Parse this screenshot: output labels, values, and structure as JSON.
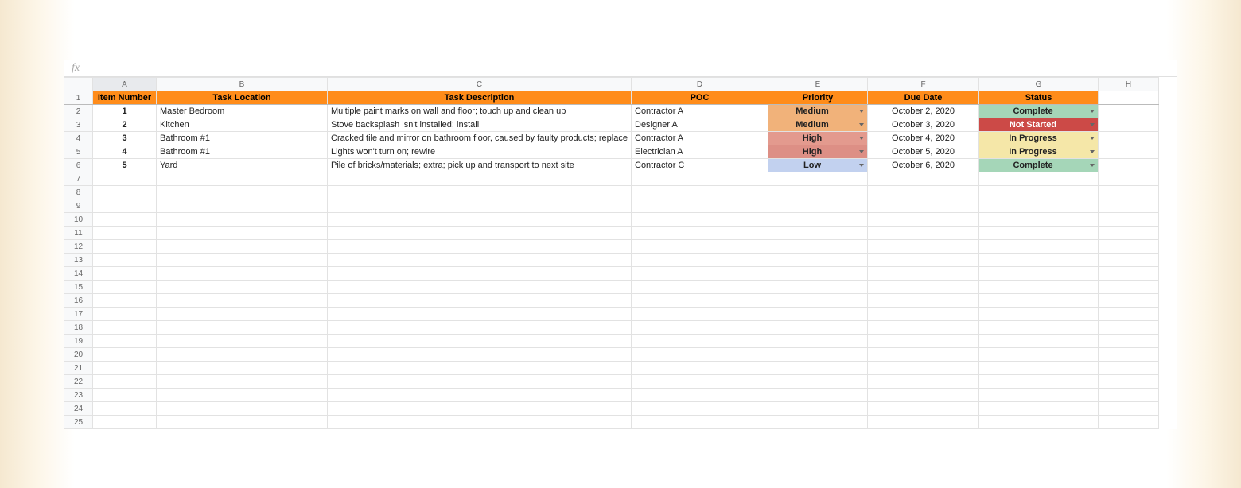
{
  "formula_bar": {
    "fx_label": "fx",
    "value": ""
  },
  "columns": [
    "A",
    "B",
    "C",
    "D",
    "E",
    "F",
    "G",
    "H"
  ],
  "headers": {
    "item_number": "Item Number",
    "task_location": "Task Location",
    "task_description": "Task Description",
    "poc": "POC",
    "priority": "Priority",
    "due_date": "Due Date",
    "status": "Status"
  },
  "rows": [
    {
      "num": "1",
      "item": "1",
      "loc": "Master Bedroom",
      "desc": "Multiple paint marks on wall and floor; touch up and clean up",
      "poc": "Contractor A",
      "prio": "Medium",
      "prio_class": "prio-medium",
      "due": "October 2, 2020",
      "status": "Complete",
      "status_class": "stat-complete"
    },
    {
      "num": "2",
      "item": "2",
      "loc": "Kitchen",
      "desc": "Stove backsplash isn't installed; install",
      "poc": "Designer A",
      "prio": "Medium",
      "prio_class": "prio-medium",
      "due": "October 3, 2020",
      "status": "Not Started",
      "status_class": "stat-notstarted"
    },
    {
      "num": "3",
      "item": "3",
      "loc": "Bathroom #1",
      "desc": "Cracked tile and mirror on bathroom floor, caused by faulty products; replace",
      "poc": "Contractor A",
      "prio": "High",
      "prio_class": "prio-high-1",
      "due": "October 4, 2020",
      "status": "In Progress",
      "status_class": "stat-inprogress"
    },
    {
      "num": "4",
      "item": "4",
      "loc": "Bathroom #1",
      "desc": "Lights won't turn on; rewire",
      "poc": "Electrician A",
      "prio": "High",
      "prio_class": "prio-high-2",
      "due": "October 5, 2020",
      "status": "In Progress",
      "status_class": "stat-inprogress"
    },
    {
      "num": "5",
      "item": "5",
      "loc": "Yard",
      "desc": "Pile of bricks/materials; extra; pick up and transport to next site",
      "poc": "Contractor C",
      "prio": "Low",
      "prio_class": "prio-low",
      "due": "October 6, 2020",
      "status": "Complete",
      "status_class": "stat-complete"
    }
  ],
  "empty_row_start": 7,
  "empty_row_end": 25
}
